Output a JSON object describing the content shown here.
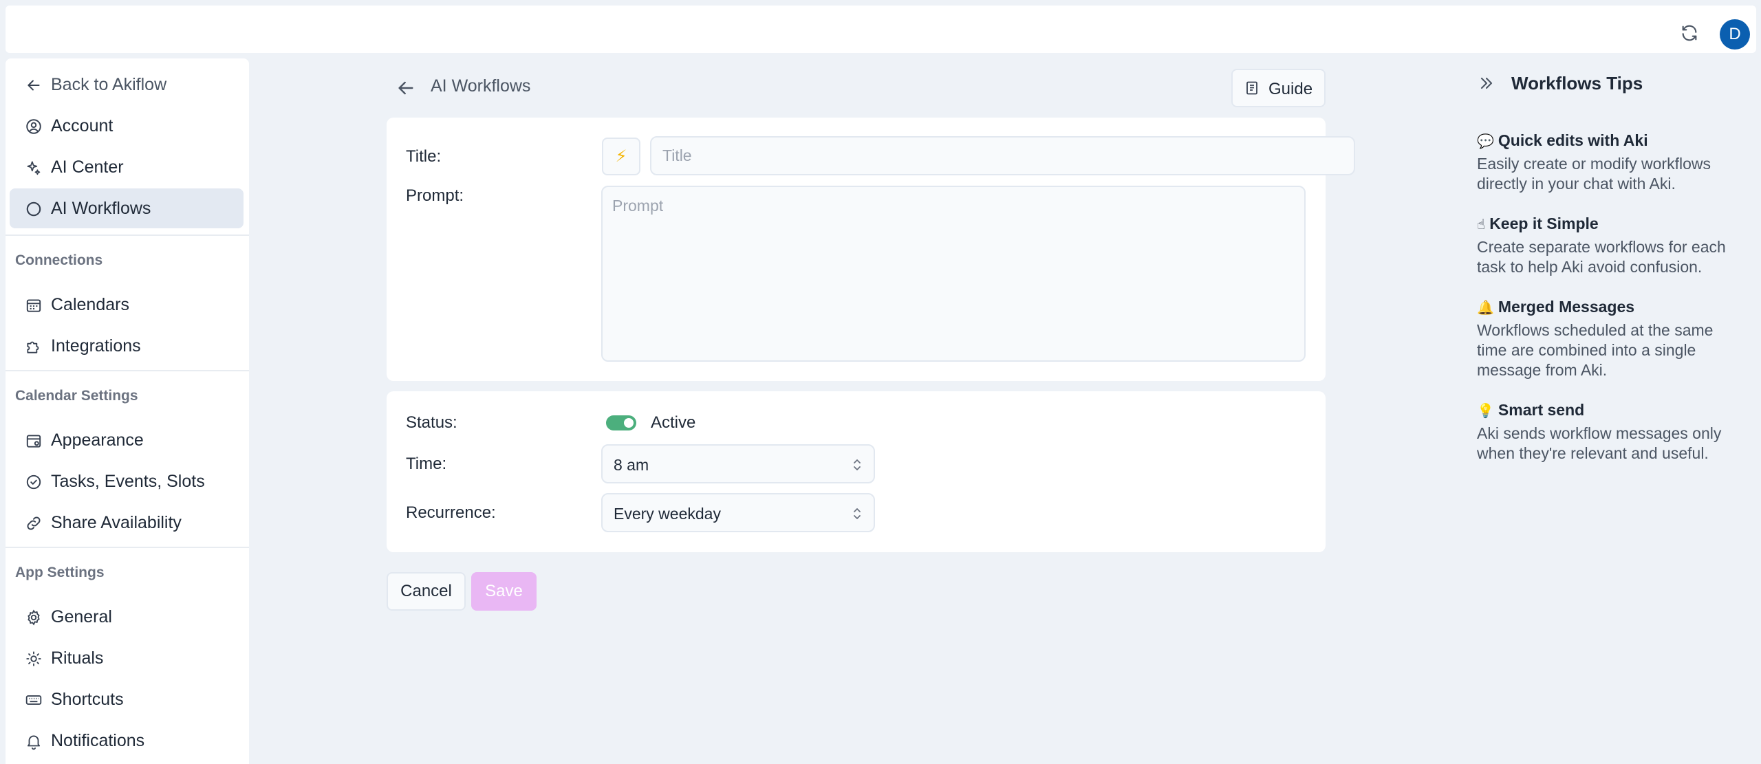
{
  "topbar": {
    "avatar_initial": "D"
  },
  "sidebar": {
    "back_label": "Back to Akiflow",
    "items_top": [
      {
        "label": "Account",
        "icon": "user-circle-icon"
      },
      {
        "label": "AI Center",
        "icon": "sparkles-icon"
      },
      {
        "label": "AI Workflows",
        "icon": "circle-icon",
        "active": true
      }
    ],
    "sections": [
      {
        "title": "Connections",
        "items": [
          {
            "label": "Calendars",
            "icon": "calendar-icon"
          },
          {
            "label": "Integrations",
            "icon": "puzzle-icon"
          }
        ]
      },
      {
        "title": "Calendar Settings",
        "items": [
          {
            "label": "Appearance",
            "icon": "calendar-settings-icon"
          },
          {
            "label": "Tasks, Events, Slots",
            "icon": "check-circle-icon"
          },
          {
            "label": "Share Availability",
            "icon": "link-icon"
          }
        ]
      },
      {
        "title": "App Settings",
        "items": [
          {
            "label": "General",
            "icon": "gear-icon"
          },
          {
            "label": "Rituals",
            "icon": "sun-icon"
          },
          {
            "label": "Shortcuts",
            "icon": "keyboard-icon"
          },
          {
            "label": "Notifications",
            "icon": "bell-icon"
          }
        ]
      }
    ]
  },
  "main": {
    "page_title": "AI Workflows",
    "guide_label": "Guide",
    "form": {
      "title_label": "Title:",
      "title_placeholder": "Title",
      "title_value": "",
      "icon_glyph": "⚡",
      "prompt_label": "Prompt:",
      "prompt_placeholder": "Prompt",
      "status_label": "Status:",
      "status_value": "Active",
      "status_on": true,
      "time_label": "Time:",
      "time_value": "8 am",
      "recurrence_label": "Recurrence:",
      "recurrence_value": "Every weekday"
    },
    "cancel_label": "Cancel",
    "save_label": "Save"
  },
  "tips": {
    "title": "Workflows Tips",
    "items": [
      {
        "emoji": "💬",
        "heading": "Quick edits with Aki",
        "body": "Easily create or modify workflows directly in your chat with Aki."
      },
      {
        "emoji": "☝",
        "heading": "Keep it Simple",
        "body": "Create separate workflows for each task to help Aki avoid confusion."
      },
      {
        "emoji": "🔔",
        "heading": "Merged Messages",
        "body": "Workflows scheduled at the same time are combined into a single message from Aki."
      },
      {
        "emoji": "💡",
        "heading": "Smart send",
        "body": "Aki sends workflow messages only when they're relevant and useful."
      }
    ]
  },
  "colors": {
    "background": "#eef2f7",
    "active_nav": "#e3e9f2",
    "toggle_on": "#4caf7d",
    "save_disabled": "#e9b7f4",
    "avatar": "#0b5fb0"
  }
}
